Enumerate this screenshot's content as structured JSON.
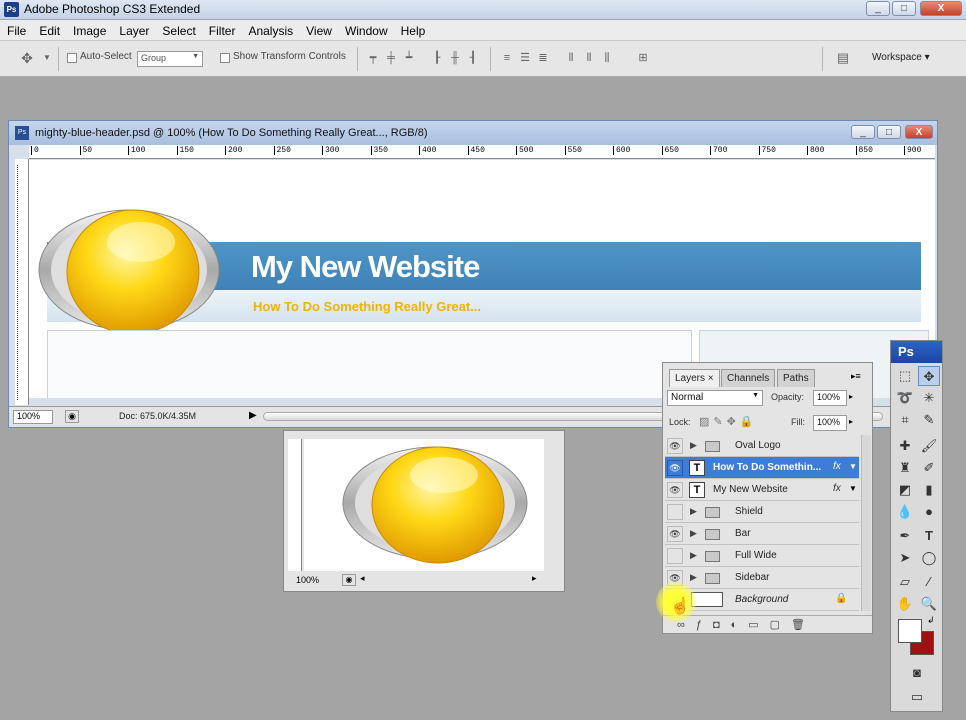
{
  "app": {
    "title": "Adobe Photoshop CS3 Extended",
    "badge": "Ps"
  },
  "window_buttons": {
    "minimize": "_",
    "maximize": "□",
    "close": "X"
  },
  "menu": [
    "File",
    "Edit",
    "Image",
    "Layer",
    "Select",
    "Filter",
    "Analysis",
    "View",
    "Window",
    "Help"
  ],
  "options": {
    "auto_select_label": "Auto-Select",
    "auto_select_value": "Group",
    "show_transform_label": "Show Transform Controls",
    "workspace_label": "Workspace ▾"
  },
  "document": {
    "title": "mighty-blue-header.psd @ 100% (How To Do Something Really Great..., RGB/8)",
    "ruler_ticks": [
      "0",
      "50",
      "100",
      "150",
      "200",
      "250",
      "300",
      "350",
      "400",
      "450",
      "500",
      "550",
      "600",
      "650",
      "700",
      "750",
      "800",
      "850",
      "900"
    ],
    "zoom": "100%",
    "doc_info": "Doc: 675.0K/4.35M",
    "site_title": "My New Website",
    "site_subtitle": "How To Do Something Really Great..."
  },
  "doc2": {
    "zoom": "100%"
  },
  "layers_panel": {
    "tabs": [
      "Layers ×",
      "Channels",
      "Paths"
    ],
    "blend_mode": "Normal",
    "opacity_label": "Opacity:",
    "opacity_value": "100%",
    "lock_label": "Lock:",
    "fill_label": "Fill:",
    "fill_value": "100%",
    "layers": [
      {
        "name": "Oval Logo",
        "kind": "group",
        "visible": true
      },
      {
        "name": "How To Do Somethin...",
        "kind": "text",
        "visible": true,
        "selected": true,
        "fx": true
      },
      {
        "name": "My New Website",
        "kind": "text",
        "visible": true,
        "fx": true
      },
      {
        "name": "Shield",
        "kind": "group",
        "visible": false
      },
      {
        "name": "Bar",
        "kind": "group",
        "visible": true
      },
      {
        "name": "Full Wide",
        "kind": "group",
        "visible": false
      },
      {
        "name": "Sidebar",
        "kind": "group",
        "visible": true
      },
      {
        "name": "Background",
        "kind": "background",
        "visible": true
      }
    ]
  },
  "tools_panel": {
    "header": "Ps"
  },
  "colors": {
    "accent_blue": "#3f7cd6",
    "banner_blue": "#4f95c8",
    "subtitle_gold": "#f0b400",
    "background_red": "#a01010"
  }
}
